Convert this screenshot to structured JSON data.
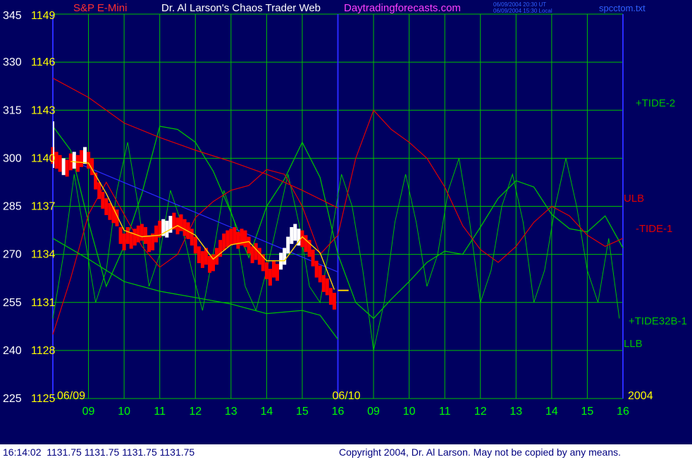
{
  "header": {
    "left_title": "S&P E-Mini",
    "center_title": "Dr. Al Larson's Chaos Trader Web",
    "site": "Daytradingforecasts.com",
    "stamp_line1": "06/09/2004 20:30 UT",
    "stamp_line2": "06/09/2004 15:30 Local",
    "file": "spcctom.txt"
  },
  "footer": {
    "quote": "16:14:02  1131.75 1131.75 1131.75 1131.75",
    "copyright": "Copyright 2004, Dr. Al Larson. May not be copied by any means."
  },
  "colors": {
    "background": "#000060",
    "grid": "#00c000",
    "day_line": "#2a2aff",
    "price_up": "#ff0000",
    "price_white": "#ffffff",
    "avg": "#ffd700",
    "tide": "#00c000",
    "red_curve": "#e00000"
  },
  "chart_data": {
    "type": "line",
    "y_axis_left": {
      "ticks_a": [
        345,
        330,
        315,
        300,
        285,
        270,
        255,
        240,
        225
      ],
      "ticks_b": [
        1149,
        1146,
        1143,
        1140,
        1137,
        1134,
        1131,
        1128,
        1125
      ],
      "ylim": [
        1125,
        1149
      ]
    },
    "x_axis": {
      "date_labels": [
        "06/09",
        "06/10",
        "2004"
      ],
      "hour_ticks": [
        "09",
        "10",
        "11",
        "12",
        "13",
        "14",
        "15",
        "16",
        "09",
        "10",
        "11",
        "12",
        "13",
        "14",
        "15",
        "16"
      ]
    },
    "right_labels": [
      "+TIDE-2",
      "ULB",
      "-TIDE-1",
      "+TIDE32B-1",
      "LLB"
    ],
    "series": [
      {
        "kind": "price",
        "x": [
          0,
          0.1,
          0.2,
          0.3,
          0.4,
          0.5,
          0.6,
          0.7,
          0.8,
          0.9,
          1.0,
          1.1,
          1.2,
          1.3,
          1.4,
          1.5,
          1.6,
          1.7,
          1.8,
          1.9,
          2.0,
          2.1,
          2.2,
          2.3,
          2.4,
          2.5,
          2.6,
          2.7,
          2.8,
          2.9,
          3.0,
          3.1,
          3.2,
          3.3,
          3.4,
          3.5,
          3.6,
          3.7,
          3.8,
          3.9,
          4.0,
          4.1,
          4.2,
          4.3,
          4.4,
          4.5,
          4.6,
          4.7,
          4.8,
          4.9,
          5.0,
          5.1,
          5.2,
          5.3,
          5.4,
          5.5,
          5.6,
          5.7,
          5.8,
          5.9,
          6.0,
          6.1,
          6.2,
          6.3,
          6.4,
          6.5,
          6.6,
          6.7,
          6.8,
          6.9,
          7.0,
          7.1,
          7.2,
          7.3,
          7.4,
          7.5,
          7.6,
          7.7,
          7.8,
          7.9
        ],
        "y": [
          1140.2,
          1139.9,
          1139.7,
          1139.5,
          1139.4,
          1139.8,
          1139.9,
          1139.7,
          1140.0,
          1140.2,
          1139.9,
          1139.5,
          1138.6,
          1138.0,
          1137.4,
          1137.0,
          1136.7,
          1136.5,
          1136.3,
          1135.2,
          1134.8,
          1135.2,
          1134.9,
          1135.1,
          1135.3,
          1135.4,
          1135.2,
          1134.7,
          1134.8,
          1135.3,
          1135.6,
          1135.7,
          1135.6,
          1135.9,
          1136.1,
          1135.8,
          1136.0,
          1135.7,
          1135.5,
          1135.1,
          1134.6,
          1134.0,
          1133.7,
          1133.9,
          1133.4,
          1133.5,
          1133.9,
          1134.4,
          1134.8,
          1135.0,
          1135.1,
          1135.2,
          1134.9,
          1135.1,
          1135.0,
          1134.6,
          1134.0,
          1134.2,
          1133.9,
          1133.5,
          1133.0,
          1132.6,
          1133.1,
          1132.9,
          1133.6,
          1133.9,
          1134.6,
          1135.2,
          1135.4,
          1135.1,
          1135.0,
          1134.7,
          1134.4,
          1133.8,
          1133.1,
          1132.8,
          1132.2,
          1132.0,
          1131.4,
          1131.1
        ]
      },
      {
        "kind": "avg",
        "x": [
          0.5,
          1,
          1.5,
          2,
          2.5,
          3,
          3.5,
          4,
          4.5,
          5,
          5.5,
          6,
          6.5,
          7,
          7.5,
          7.9
        ],
        "y": [
          1139.8,
          1139.7,
          1137.8,
          1135.5,
          1135.1,
          1135.2,
          1135.8,
          1135.2,
          1133.7,
          1134.6,
          1134.8,
          1133.6,
          1133.6,
          1135.1,
          1134.1,
          1131.8
        ]
      },
      {
        "kind": "ulb",
        "x": [
          0,
          1,
          2,
          3,
          4,
          5,
          6,
          7,
          8
        ],
        "y": [
          1145,
          1143.8,
          1142.2,
          1141.3,
          1140.5,
          1139.8,
          1139.0,
          1138.0,
          1136.9
        ]
      },
      {
        "kind": "llb",
        "x": [
          0,
          1,
          2,
          3,
          4,
          5,
          6,
          7,
          7.5,
          8
        ],
        "y": [
          1135.0,
          1133.7,
          1132.3,
          1131.7,
          1131.3,
          1130.9,
          1130.3,
          1130.5,
          1130.2,
          1128.7
        ]
      },
      {
        "kind": "tide_minus1",
        "x": [
          0,
          0.5,
          1,
          1.5,
          2,
          2.5,
          3,
          3.5,
          4,
          4.5,
          5,
          5.5,
          6,
          6.5,
          7,
          7.5,
          8,
          8.5,
          9,
          9.5,
          10,
          10.5,
          11,
          11.5,
          12,
          12.5,
          13,
          13.5,
          14,
          14.5,
          15,
          15.5,
          16
        ],
        "y": [
          1129,
          1132.5,
          1136.5,
          1138.5,
          1136.5,
          1134.5,
          1133.2,
          1134,
          1136.3,
          1137.3,
          1138,
          1138.3,
          1139.3,
          1139.0,
          1137.0,
          1134.0,
          1135.2,
          1140.0,
          1143.0,
          1141.8,
          1141.0,
          1140.0,
          1138.2,
          1135.8,
          1134.3,
          1133.5,
          1134.5,
          1136.0,
          1137.0,
          1136.4,
          1135.2,
          1134.5,
          1135.0
        ]
      },
      {
        "kind": "tide_plus2",
        "x": [
          0,
          0.5,
          1,
          1.5,
          2,
          2.5,
          3,
          3.5,
          4,
          4.5,
          5,
          5.5,
          6,
          6.5,
          7,
          7.5,
          8,
          8.5,
          9,
          9.5,
          10,
          10.5,
          11,
          11.5,
          12,
          12.5,
          13,
          13.5,
          14,
          14.5,
          15,
          15.5,
          16
        ],
        "y": [
          1142,
          1140.5,
          1136,
          1132,
          1134.5,
          1137.8,
          1142,
          1141.8,
          1141.0,
          1139.2,
          1136.6,
          1133.8,
          1137.0,
          1138.7,
          1141.0,
          1138.8,
          1134.0,
          1131.0,
          1130.0,
          1131.2,
          1132.3,
          1133.5,
          1134.2,
          1134.0,
          1135.7,
          1137.5,
          1138.6,
          1138.2,
          1136.5,
          1135.6,
          1135.4,
          1136.4,
          1134.4
        ]
      },
      {
        "kind": "tide32b",
        "x": [
          0,
          0.3,
          0.6,
          0.9,
          1.2,
          1.5,
          1.8,
          2.1,
          2.4,
          2.7,
          3.0,
          3.3,
          3.6,
          3.9,
          4.2,
          4.5,
          4.8,
          5.1,
          5.4,
          5.7,
          6.0,
          6.3,
          6.6,
          6.9,
          7.2,
          7.5,
          7.8,
          8.1,
          8.4,
          8.7,
          9.0,
          9.3,
          9.6,
          9.9,
          10.2,
          10.5,
          10.8,
          11.1,
          11.4,
          11.7,
          12.0,
          12.3,
          12.6,
          12.9,
          13.2,
          13.5,
          13.8,
          14.1,
          14.4,
          14.7,
          15.0,
          15.3,
          15.6,
          15.9
        ],
        "y": [
          1130,
          1134,
          1139,
          1135,
          1131,
          1133,
          1138,
          1141,
          1137,
          1132,
          1134,
          1138,
          1136,
          1133,
          1130.5,
          1134,
          1138,
          1136,
          1132,
          1130.5,
          1133,
          1136,
          1139,
          1136,
          1132,
          1131,
          1135,
          1139,
          1137,
          1133,
          1128,
          1131,
          1136,
          1139,
          1136,
          1132,
          1134,
          1138,
          1140,
          1136,
          1131,
          1133,
          1137,
          1139,
          1136,
          1131,
          1133,
          1137,
          1140,
          1137,
          1133,
          1131,
          1135,
          1130
        ]
      },
      {
        "kind": "trend",
        "x": [
          0.8,
          8
        ],
        "y": [
          1139.6,
          1132.9
        ]
      },
      {
        "kind": "last_tick",
        "x": [
          8,
          8.3
        ],
        "y": [
          1131.75,
          1131.75
        ]
      }
    ]
  }
}
